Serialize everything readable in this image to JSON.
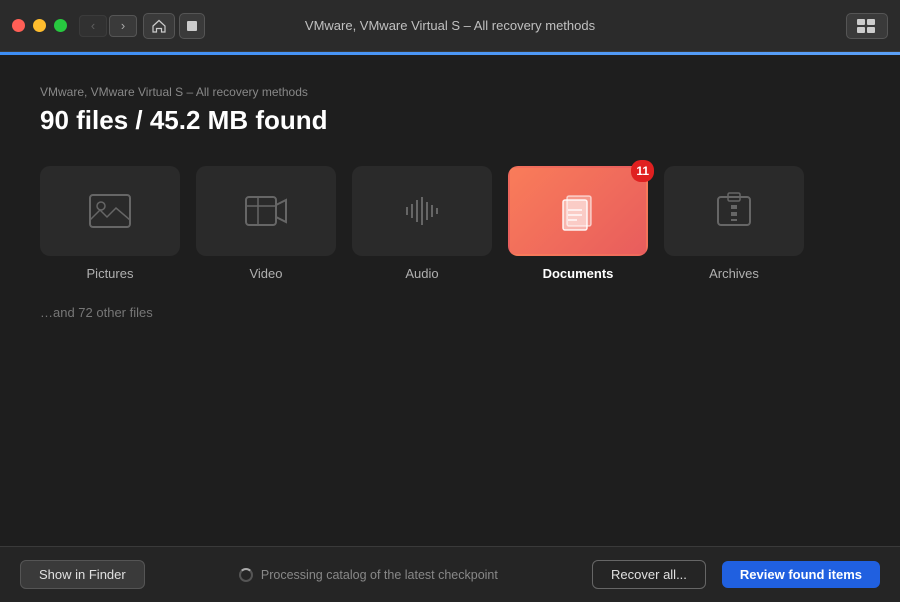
{
  "titleBar": {
    "title": "VMware, VMware Virtual S – All recovery methods"
  },
  "breadcrumb": "VMware, VMware Virtual S – All recovery methods",
  "pageTitle": "90 files / 45.2 MB found",
  "categories": [
    {
      "id": "pictures",
      "label": "Pictures",
      "active": false,
      "badge": null,
      "iconType": "picture"
    },
    {
      "id": "video",
      "label": "Video",
      "active": false,
      "badge": null,
      "iconType": "video"
    },
    {
      "id": "audio",
      "label": "Audio",
      "active": false,
      "badge": null,
      "iconType": "audio"
    },
    {
      "id": "documents",
      "label": "Documents",
      "active": true,
      "badge": "11",
      "iconType": "documents"
    },
    {
      "id": "archives",
      "label": "Archives",
      "active": false,
      "badge": null,
      "iconType": "archives"
    }
  ],
  "otherFiles": "…and 72 other files",
  "bottomBar": {
    "showInFinder": "Show in Finder",
    "processingText": "Processing catalog of the latest checkpoint",
    "recoverAll": "Recover all...",
    "reviewFoundItems": "Review found items"
  }
}
